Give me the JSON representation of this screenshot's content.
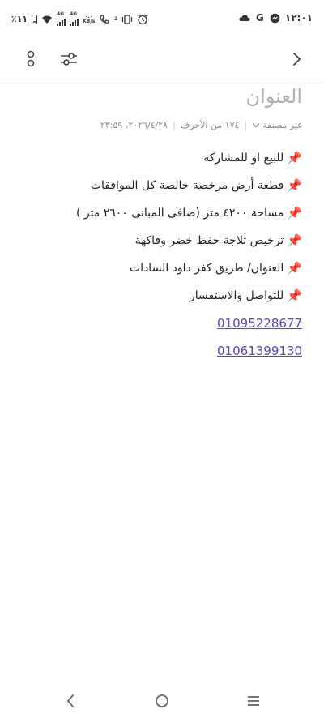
{
  "status_bar": {
    "time": "١٢:٠١",
    "battery": "٪١١",
    "network_1": "4G",
    "network_2": "4G",
    "speed_value": "٠.٠",
    "speed_unit": "KB/s",
    "sim_slot": "2",
    "icons_right": [
      "clock-icon",
      "messenger-icon",
      "google-icon",
      "cloud-icon"
    ]
  },
  "toolbar": {
    "back_icon": "chevron-right-icon",
    "settings_icon": "sliders-icon",
    "more_icon": "more-vertical-icon"
  },
  "note": {
    "title_placeholder": "العنوان",
    "category": "غير مصنفة",
    "char_count": "١٧٤ من الأحرف",
    "datetime": "٢٠٢٦/٤/٢٨، ٢٣:٥٩"
  },
  "content": {
    "lines": [
      {
        "pin": "📌",
        "text": "للبيع او للمشاركة"
      },
      {
        "pin": "📌",
        "text": "قطعة أرض مرخصة خالصة كل الموافقات"
      },
      {
        "pin": "📌",
        "text": "مساحة ٤٢٠٠ متر (صافى المبانى ٢٦٠٠ متر )"
      },
      {
        "pin": "📌",
        "text": "ترخيص ثلاجة حفظ خضر وفاكهة"
      },
      {
        "pin": "📌",
        "text": "العنوان/ طريق كفر داود السادات"
      },
      {
        "pin": "📌",
        "text": "للتواصل والاستفسار"
      }
    ],
    "phones": [
      "01095228677",
      "01061399130"
    ]
  },
  "colors": {
    "link": "#5546c9",
    "title_placeholder": "#b0b0b0",
    "meta": "#8a8a8a"
  },
  "nav": {
    "back_icon": "nav-back-icon",
    "home_icon": "nav-home-icon",
    "menu_icon": "nav-recents-icon"
  }
}
